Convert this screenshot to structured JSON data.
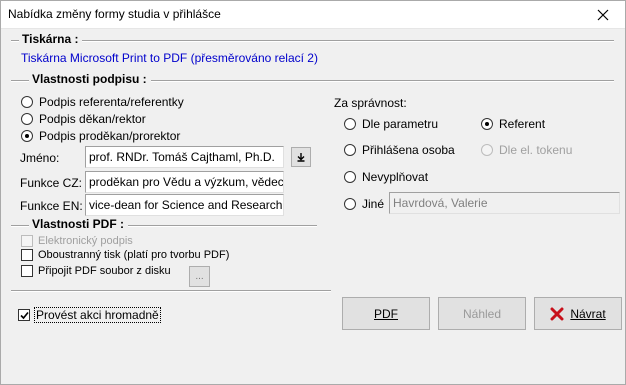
{
  "window": {
    "title": "Nabídka změny formy studia v přihlášce"
  },
  "printer_group": {
    "title": "Tiskárna :",
    "printer_name": "Tiskárna Microsoft Print to PDF (přesměrováno relací 2)"
  },
  "signature_group": {
    "title": "Vlastnosti podpisu :",
    "options": [
      "Podpis referenta/referentky",
      "Podpis děkan/rektor",
      "Podpis proděkan/prorektor"
    ],
    "selected_index": 2,
    "name_label": "Jméno:",
    "name_value": "prof. RNDr. Tomáš Cajthaml, Ph.D.",
    "function_cz_label": "Funkce CZ:",
    "function_cz_value": "proděkan pro Vědu a výzkum, vědec",
    "function_en_label": "Funkce EN:",
    "function_en_value": "vice-dean for Science and Research"
  },
  "correctness": {
    "label": "Za správnost:",
    "options": {
      "by_parameter": "Dle parametru",
      "referent": "Referent",
      "logged_user": "Přihlášena osoba",
      "by_token": "Dle el. tokenu",
      "not_filled": "Nevyplňovat",
      "other": "Jiné"
    },
    "selected": "referent",
    "other_value": "Havrdová, Valerie"
  },
  "pdf_group": {
    "title": "Vlastnosti PDF :",
    "electronic_signature": "Elektronický podpis",
    "duplex": "Oboustranný tisk (platí pro tvorbu PDF)",
    "attach_pdf": "Připojit PDF soubor z disku",
    "browse": "..."
  },
  "bulk_action": {
    "label": "Provést akci hromadně",
    "checked": true
  },
  "buttons": {
    "pdf": "PDF",
    "preview": "Náhled",
    "back": "Návrat"
  }
}
